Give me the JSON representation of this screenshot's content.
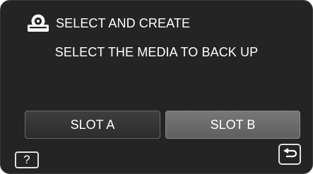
{
  "header": {
    "icon": "disc-drive-icon",
    "title": "SELECT AND CREATE"
  },
  "prompt": "SELECT THE MEDIA TO BACK UP",
  "slots": [
    {
      "label": "SLOT A",
      "selected": false
    },
    {
      "label": "SLOT B",
      "selected": true
    }
  ],
  "help_button": {
    "label": "?",
    "icon": "help-icon"
  },
  "back_button": {
    "icon": "return-arrow-icon"
  },
  "colors": {
    "background": "#242424",
    "text": "#ffffff",
    "button_default": "#353535",
    "button_selected": "#6b6b6b"
  }
}
